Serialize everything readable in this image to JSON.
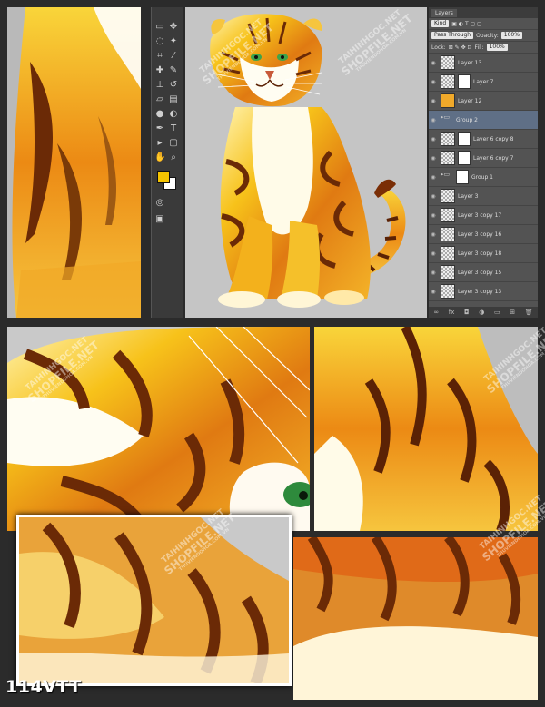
{
  "layers_panel": {
    "tab": "Layers",
    "filter": "Kind",
    "blend_mode": "Pass Through",
    "opacity_label": "Opacity:",
    "opacity_value": "100%",
    "lock_label": "Lock:",
    "fill_label": "Fill:",
    "fill_value": "100%",
    "layers": [
      {
        "name": "Layer 13",
        "thumb": "check",
        "mask": false,
        "selected": false
      },
      {
        "name": "Layer 7",
        "thumb": "check",
        "mask": true,
        "selected": false
      },
      {
        "name": "Layer 12",
        "thumb": "tiger",
        "mask": false,
        "selected": false
      },
      {
        "name": "Group 2",
        "thumb": "folder",
        "mask": false,
        "selected": true
      },
      {
        "name": "Layer 6 copy 8",
        "thumb": "check",
        "mask": true,
        "selected": false
      },
      {
        "name": "Layer 6 copy 7",
        "thumb": "check",
        "mask": true,
        "selected": false
      },
      {
        "name": "Group 1",
        "thumb": "folder",
        "mask": true,
        "selected": false
      },
      {
        "name": "Layer 3",
        "thumb": "check",
        "mask": false,
        "selected": false
      },
      {
        "name": "Layer 3 copy 17",
        "thumb": "check",
        "mask": false,
        "selected": false
      },
      {
        "name": "Layer 3 copy 16",
        "thumb": "check",
        "mask": false,
        "selected": false
      },
      {
        "name": "Layer 3 copy 18",
        "thumb": "check",
        "mask": false,
        "selected": false
      },
      {
        "name": "Layer 3 copy 15",
        "thumb": "check",
        "mask": false,
        "selected": false
      },
      {
        "name": "Layer 3 copy 13",
        "thumb": "check",
        "mask": false,
        "selected": false
      }
    ]
  },
  "watermark": {
    "line1": "TAIHINHGOC.NET",
    "line2": "SHOPFILE.NET",
    "line3": "THUVIENDOHOA.COM.VN"
  },
  "product_code": "114VTT",
  "colors": {
    "foreground_swatch": "#f5c400",
    "background_swatch": "#ffffff",
    "selection": "#5f6f86"
  },
  "icons": {
    "visibility": "eye-icon",
    "folder": "folder-icon"
  }
}
